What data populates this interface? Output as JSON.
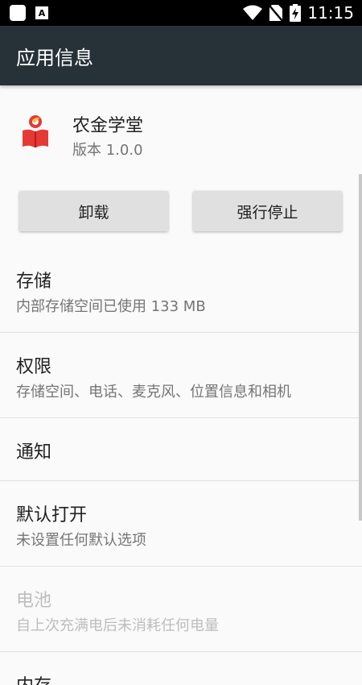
{
  "status_bar": {
    "time": "11:15",
    "icons": [
      "app-square-icon",
      "a-notification-icon",
      "wifi-icon",
      "no-sim-icon",
      "battery-charging-icon"
    ]
  },
  "app_bar": {
    "title": "应用信息"
  },
  "app": {
    "name": "农金学堂",
    "version": "版本 1.0.0",
    "icon": "book-app-icon",
    "icon_colors": {
      "primary": "#e53935",
      "accent": "#fbc02d"
    }
  },
  "buttons": {
    "uninstall": "卸载",
    "force_stop": "强行停止"
  },
  "rows": [
    {
      "title": "存储",
      "subtitle": "内部存储空间已使用 133 MB",
      "enabled": true
    },
    {
      "title": "权限",
      "subtitle": "存储空间、电话、麦克风、位置信息和相机",
      "enabled": true
    },
    {
      "title": "通知",
      "subtitle": "",
      "enabled": true
    },
    {
      "title": "默认打开",
      "subtitle": "未设置任何默认选项",
      "enabled": true
    },
    {
      "title": "电池",
      "subtitle": "自上次充满电后未消耗任何电量",
      "enabled": false
    },
    {
      "title": "内存",
      "subtitle": "",
      "enabled": true
    }
  ],
  "colors": {
    "app_bar": "#263238",
    "button": "#e0e0e0",
    "divider": "#e0e0e0"
  }
}
